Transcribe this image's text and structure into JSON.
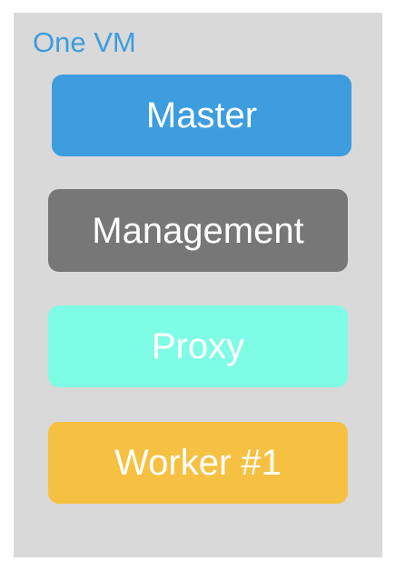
{
  "vm": {
    "title": "One VM",
    "title_color": "#3d9ddf",
    "background_color": "#d9d9d9"
  },
  "nodes": [
    {
      "label": "Master",
      "color": "#3d9ddf"
    },
    {
      "label": "Management",
      "color": "#777777"
    },
    {
      "label": "Proxy",
      "color": "#7ffce6"
    },
    {
      "label": "Worker #1",
      "color": "#f6c142"
    }
  ]
}
